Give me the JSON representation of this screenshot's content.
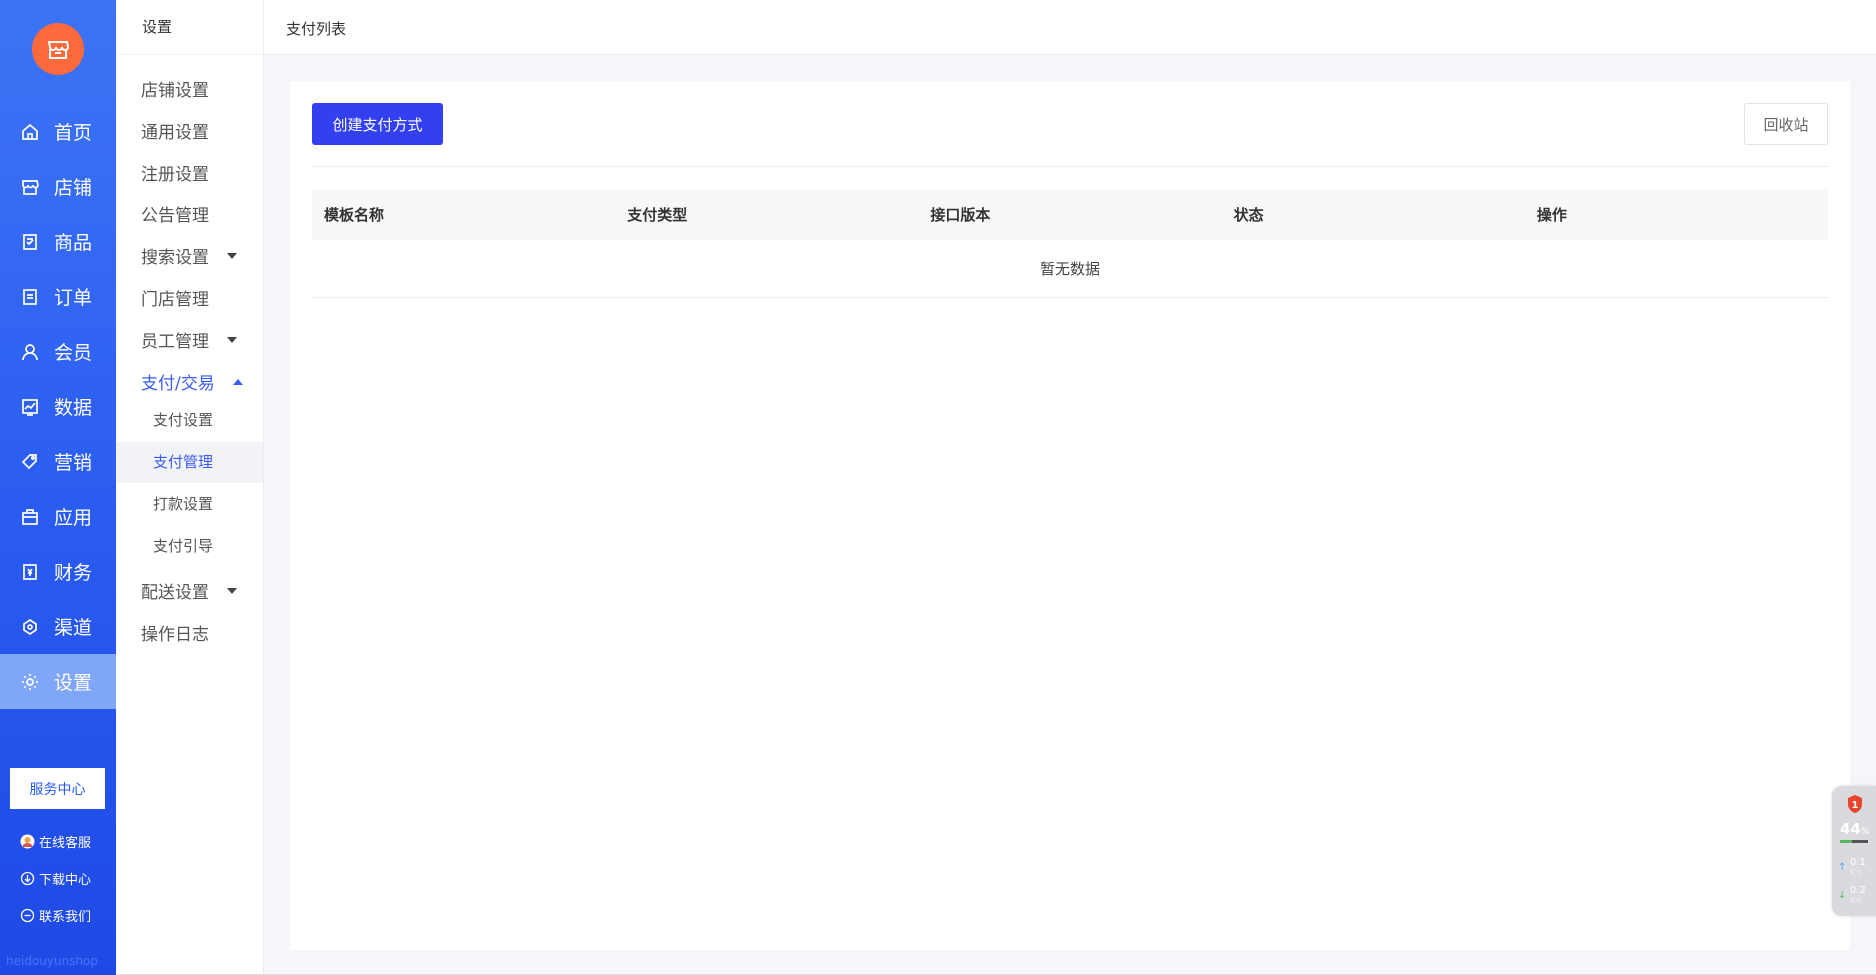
{
  "rail": {
    "items": [
      {
        "label": "首页",
        "icon": "home-icon"
      },
      {
        "label": "店铺",
        "icon": "store-icon"
      },
      {
        "label": "商品",
        "icon": "goods-icon"
      },
      {
        "label": "订单",
        "icon": "order-icon"
      },
      {
        "label": "会员",
        "icon": "user-icon"
      },
      {
        "label": "数据",
        "icon": "chart-icon"
      },
      {
        "label": "营销",
        "icon": "tag-icon"
      },
      {
        "label": "应用",
        "icon": "app-icon"
      },
      {
        "label": "财务",
        "icon": "finance-icon"
      },
      {
        "label": "渠道",
        "icon": "channel-icon"
      },
      {
        "label": "设置",
        "icon": "gear-icon"
      }
    ],
    "service_center": "服务中心",
    "links": [
      {
        "label": "在线客服"
      },
      {
        "label": "下载中心"
      },
      {
        "label": "联系我们"
      }
    ],
    "footer": "heidouyunshop"
  },
  "subnav": {
    "title": "设置",
    "items": [
      {
        "label": "店铺设置"
      },
      {
        "label": "通用设置"
      },
      {
        "label": "注册设置"
      },
      {
        "label": "公告管理"
      },
      {
        "label": "搜索设置"
      },
      {
        "label": "门店管理"
      },
      {
        "label": "员工管理"
      },
      {
        "label": "支付/交易"
      },
      {
        "label": "配送设置"
      },
      {
        "label": "操作日志"
      }
    ],
    "sub_items": [
      {
        "label": "支付设置"
      },
      {
        "label": "支付管理"
      },
      {
        "label": "打款设置"
      },
      {
        "label": "支付引导"
      }
    ]
  },
  "header": {
    "breadcrumb": "支付列表"
  },
  "main": {
    "create_button": "创建支付方式",
    "recycle_button": "回收站",
    "columns": [
      "模板名称",
      "支付类型",
      "接口版本",
      "状态",
      "操作"
    ],
    "empty_text": "暂无数据"
  },
  "widget": {
    "percent": "44",
    "percent_unit": "%",
    "badge": "1",
    "up": "0.1",
    "down": "0.2",
    "unit": "K/s",
    "progress": 0.44
  },
  "colors": {
    "rail": "#2a5bf0",
    "accent": "#3340f0",
    "logo": "#ff6a3d"
  }
}
